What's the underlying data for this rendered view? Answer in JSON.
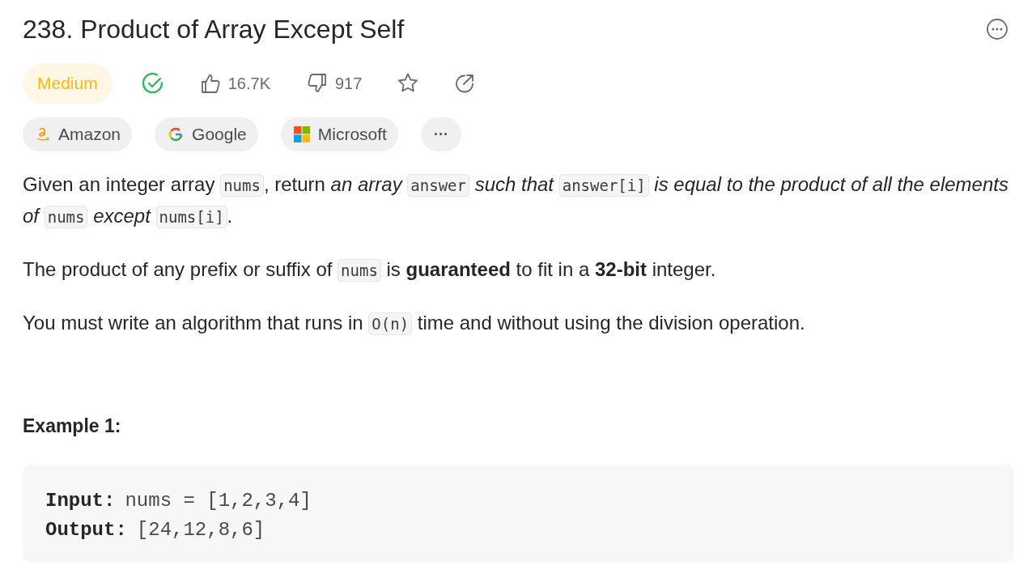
{
  "title": "238. Product of Array Except Self",
  "difficulty": {
    "label": "Medium",
    "kind": "medium"
  },
  "solved": true,
  "likes": "16.7K",
  "dislikes": "917",
  "companies": [
    {
      "name": "Amazon",
      "kind": "amazon"
    },
    {
      "name": "Google",
      "kind": "google"
    },
    {
      "name": "Microsoft",
      "kind": "microsoft"
    }
  ],
  "more_companies": "···",
  "paragraphs": [
    [
      {
        "kind": "text",
        "text": "Given an integer array "
      },
      {
        "kind": "code",
        "text": "nums"
      },
      {
        "kind": "text",
        "text": ", return *an array* "
      },
      {
        "kind": "code",
        "text": "answer"
      },
      {
        "kind": "text",
        "text": " *such that* "
      },
      {
        "kind": "code",
        "text": "answer[i]"
      },
      {
        "kind": "text",
        "text": " *is equal to the product of all the elements of* "
      },
      {
        "kind": "code",
        "text": "nums"
      },
      {
        "kind": "text",
        "text": " *except* "
      },
      {
        "kind": "code",
        "text": "nums[i]"
      },
      {
        "kind": "text",
        "text": "."
      }
    ],
    [
      {
        "kind": "text",
        "text": "The product of any prefix or suffix of "
      },
      {
        "kind": "code",
        "text": "nums"
      },
      {
        "kind": "text",
        "text": " is **guaranteed** to fit in a **32-bit** integer."
      }
    ],
    [
      {
        "kind": "text",
        "text": "You must write an algorithm that runs in "
      },
      {
        "kind": "code",
        "text": "O(n)"
      },
      {
        "kind": "text",
        "text": " time and without using the division operation."
      }
    ]
  ],
  "examples": [
    {
      "title": "Example 1:",
      "lines": [
        {
          "label": "Input:",
          "value": "nums = [1,2,3,4]"
        },
        {
          "label": "Output:",
          "value": "[24,12,8,6]"
        }
      ]
    }
  ]
}
